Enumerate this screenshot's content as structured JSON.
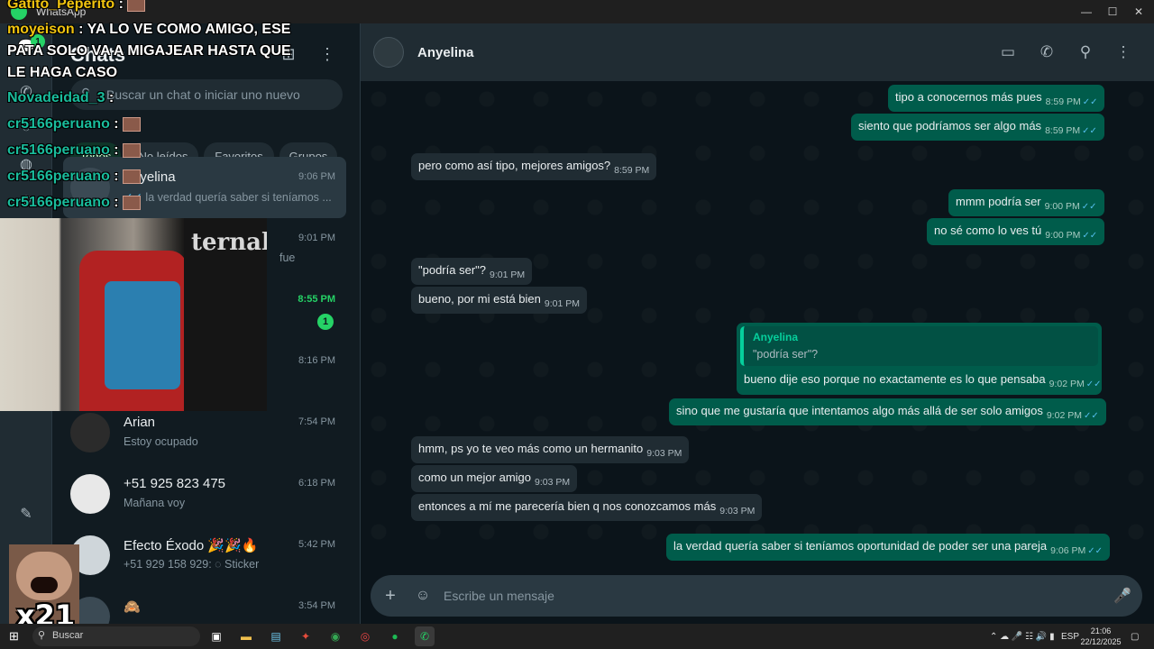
{
  "window": {
    "title": "WhatsApp",
    "controls": [
      "—",
      "☐",
      "✕"
    ]
  },
  "sidebar_rail": {
    "badge": "1"
  },
  "chat_list": {
    "title": "Chats",
    "search_placeholder": "Buscar un chat o iniciar uno nuevo",
    "filters": [
      "Todos",
      "No leídos",
      "Favoritos",
      "Grupos"
    ],
    "chats": [
      {
        "name": "Anyelina",
        "preview": "la verdad quería saber si teníamos ...",
        "time": "9:06 PM",
        "selected": true
      },
      {
        "name": "",
        "preview": "fue",
        "time": "9:01 PM"
      },
      {
        "name": "",
        "preview": "",
        "time": "8:55 PM",
        "unread": "1"
      },
      {
        "name": "",
        "preview": "",
        "time": "8:16 PM"
      },
      {
        "name": "Arian",
        "preview": "Estoy ocupado",
        "time": "7:54 PM"
      },
      {
        "name": "+51 925 823 475",
        "preview": "Mañana voy",
        "time": "6:18 PM"
      },
      {
        "name": "Efecto Éxodo 🎉🎉🔥",
        "preview": "+51 929 158 929: ◌ Sticker",
        "time": "5:42 PM"
      },
      {
        "name": "🙈",
        "preview": "",
        "time": "3:54 PM"
      }
    ]
  },
  "conversation": {
    "contact_name": "Anyelina",
    "composer_placeholder": "Escribe un mensaje",
    "messages": [
      {
        "dir": "out",
        "text": "tipo a conocernos más pues",
        "time": "8:59 PM"
      },
      {
        "dir": "out",
        "text": "siento que podríamos ser algo más",
        "time": "8:59 PM"
      },
      {
        "dir": "in",
        "text": "pero como así tipo, mejores amigos?",
        "time": "8:59 PM"
      },
      {
        "dir": "out",
        "text": "mmm podría ser",
        "time": "9:00 PM"
      },
      {
        "dir": "out",
        "text": "no sé como lo ves tú",
        "time": "9:00 PM"
      },
      {
        "dir": "in",
        "text": "\"podría ser\"?",
        "time": "9:01 PM"
      },
      {
        "dir": "in",
        "text": "bueno, por mi está bien",
        "time": "9:01 PM"
      },
      {
        "dir": "out",
        "text": "sino que me gustaría que intentamos algo más allá de ser solo amigos",
        "time": "9:02 PM"
      },
      {
        "dir": "in",
        "text": "hmm, ps yo te veo más como un hermanito",
        "time": "9:03 PM"
      },
      {
        "dir": "in",
        "text": "como un mejor amigo",
        "time": "9:03 PM"
      },
      {
        "dir": "in",
        "text": "entonces a mí me parecería bien q nos conozcamos más",
        "time": "9:03 PM"
      },
      {
        "dir": "out",
        "text": "la verdad quería saber si teníamos oportunidad de poder ser una pareja",
        "time": "9:06 PM"
      }
    ],
    "quote_message": {
      "author": "Anyelina",
      "quoted": "\"podría ser\"?",
      "text": "bueno dije eso porque no exactamente es lo que pensaba",
      "time": "9:02 PM"
    }
  },
  "stream_overlay": {
    "lines": [
      {
        "user": "Gatito_Peperito",
        "sep": " :",
        "text": "",
        "emote": true
      },
      {
        "user": "moyeison",
        "sep": " :",
        "text": " YA LO VE COMO AMIGO, ESE",
        "emote": false
      },
      {
        "user": "",
        "sep": "",
        "text": "PATA SOLO VA A MIGAJEAR HASTA QUE",
        "emote": false
      },
      {
        "user": "",
        "sep": "",
        "text": "LE HAGA CASO",
        "emote": false
      },
      {
        "user": "Novadeidad_3",
        "sep": " :",
        "text": "",
        "emote": false
      },
      {
        "user": "cr5166peruano",
        "sep": " :",
        "text": "",
        "emote": true
      },
      {
        "user": "cr5166peruano",
        "sep": " :",
        "text": "",
        "emote": true
      },
      {
        "user": "cr5166peruano",
        "sep": " :",
        "text": "",
        "emote": true
      },
      {
        "user": "cr5166peruano",
        "sep": " :",
        "text": "",
        "emote": true
      }
    ],
    "webcam_shirt_text": "ternal",
    "meme_label": "x21"
  },
  "taskbar": {
    "search_label": "Buscar",
    "language": "ESP",
    "time": "21:06",
    "date": "22/12/2025"
  }
}
